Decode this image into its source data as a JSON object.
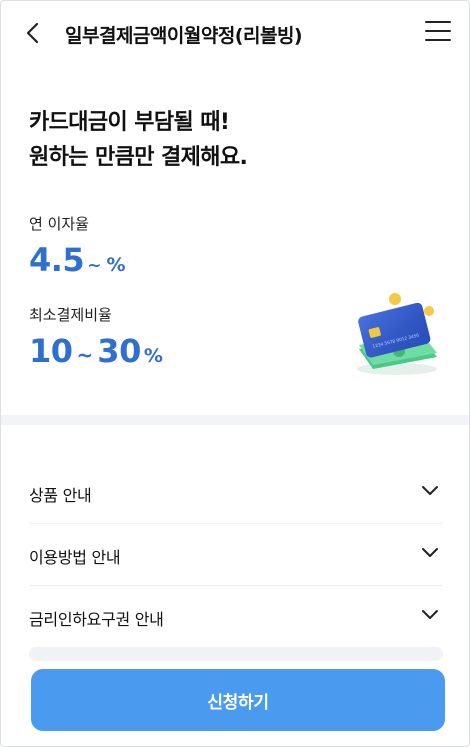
{
  "header": {
    "title": "일부결제금액이월약정(리볼빙)",
    "back_icon": "chevron-left-icon",
    "menu_icon": "hamburger-menu-icon"
  },
  "hero": {
    "headline_line1": "카드대금이 부담될 때!",
    "headline_line2": "원하는 만큼만 결제해요.",
    "interest": {
      "label": "연 이자율",
      "value": "4.5",
      "tilde": "~",
      "unit": "%"
    },
    "min_payment": {
      "label": "최소결제비율",
      "from": "10",
      "tilde": "~",
      "to": "30",
      "unit": "%"
    },
    "illustration": "credit-card-and-cash-illustration",
    "card_number_text": "1234 5678 9012 3456"
  },
  "accordion": [
    {
      "label": "상품 안내"
    },
    {
      "label": "이용방법 안내"
    },
    {
      "label": "금리인하요구권 안내"
    }
  ],
  "cta": {
    "label": "신청하기"
  },
  "colors": {
    "accent": "#2f6fcf",
    "button": "#4a9af0",
    "band": "#f2f4f6"
  }
}
